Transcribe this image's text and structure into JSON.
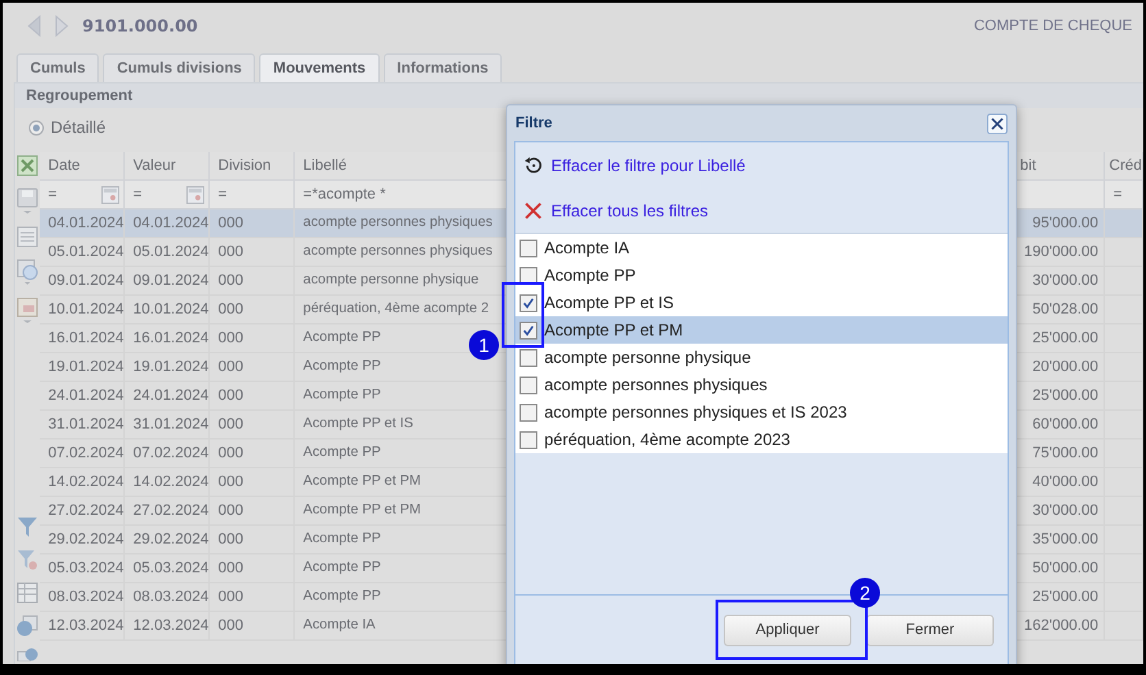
{
  "header": {
    "title": "9101.000.00",
    "account_type": "COMPTE DE CHEQUE"
  },
  "tabs": [
    {
      "label": "Cumuls",
      "selected": false
    },
    {
      "label": "Cumuls divisions",
      "selected": false
    },
    {
      "label": "Mouvements",
      "selected": true
    },
    {
      "label": "Informations",
      "selected": false
    }
  ],
  "grouping": {
    "title": "Regroupement",
    "option": {
      "label": "Détaillé",
      "selected": true
    }
  },
  "table": {
    "columns": [
      "Date",
      "Valeur",
      "Division",
      "Libellé",
      "bit",
      "Créd"
    ],
    "filters": {
      "date": "=",
      "valeur": "=",
      "division": "=",
      "libelle": "=*acompte *",
      "credit": "="
    },
    "rows": [
      {
        "cells": [
          "04.01.2024",
          "04.01.2024",
          "000",
          "acompte personnes physiques",
          "95'000.00",
          ""
        ],
        "selected": true
      },
      {
        "cells": [
          "05.01.2024",
          "05.01.2024",
          "000",
          "acompte personnes physiques",
          "190'000.00",
          ""
        ],
        "selected": false
      },
      {
        "cells": [
          "09.01.2024",
          "09.01.2024",
          "000",
          "acompte personne physique",
          "30'000.00",
          ""
        ],
        "selected": false
      },
      {
        "cells": [
          "10.01.2024",
          "10.01.2024",
          "000",
          "péréquation, 4ème acompte 2",
          "50'028.00",
          ""
        ],
        "selected": false
      },
      {
        "cells": [
          "16.01.2024",
          "16.01.2024",
          "000",
          "Acompte PP",
          "25'000.00",
          ""
        ],
        "selected": false
      },
      {
        "cells": [
          "19.01.2024",
          "19.01.2024",
          "000",
          "Acompte PP",
          "20'000.00",
          ""
        ],
        "selected": false
      },
      {
        "cells": [
          "24.01.2024",
          "24.01.2024",
          "000",
          "Acompte PP",
          "25'000.00",
          ""
        ],
        "selected": false
      },
      {
        "cells": [
          "31.01.2024",
          "31.01.2024",
          "000",
          "Acompte PP et IS",
          "60'000.00",
          ""
        ],
        "selected": false
      },
      {
        "cells": [
          "07.02.2024",
          "07.02.2024",
          "000",
          "Acompte PP",
          "75'000.00",
          ""
        ],
        "selected": false
      },
      {
        "cells": [
          "14.02.2024",
          "14.02.2024",
          "000",
          "Acompte PP et PM",
          "40'000.00",
          ""
        ],
        "selected": false
      },
      {
        "cells": [
          "27.02.2024",
          "27.02.2024",
          "000",
          "Acompte PP et PM",
          "30'000.00",
          ""
        ],
        "selected": false
      },
      {
        "cells": [
          "29.02.2024",
          "29.02.2024",
          "000",
          "Acompte PP",
          "35'000.00",
          ""
        ],
        "selected": false
      },
      {
        "cells": [
          "05.03.2024",
          "05.03.2024",
          "000",
          "Acompte PP",
          "50'000.00",
          ""
        ],
        "selected": false
      },
      {
        "cells": [
          "08.03.2024",
          "08.03.2024",
          "000",
          "Acompte PP",
          "25'000.00",
          ""
        ],
        "selected": false
      },
      {
        "cells": [
          "12.03.2024",
          "12.03.2024",
          "000",
          "Acompte IA",
          "162'000.00",
          ""
        ],
        "selected": false
      }
    ]
  },
  "dialog": {
    "title": "Filtre",
    "actions": [
      {
        "kind": "reset",
        "label": "Effacer le filtre pour Libellé"
      },
      {
        "kind": "clear",
        "label": "Effacer tous les filtres"
      }
    ],
    "options": [
      {
        "label": "Acompte IA",
        "checked": false,
        "selected": false
      },
      {
        "label": "Acompte PP",
        "checked": false,
        "selected": false
      },
      {
        "label": "Acompte PP et IS",
        "checked": true,
        "selected": false
      },
      {
        "label": "Acompte PP et PM",
        "checked": true,
        "selected": true
      },
      {
        "label": "acompte personne physique",
        "checked": false,
        "selected": false
      },
      {
        "label": "acompte personnes physiques",
        "checked": false,
        "selected": false
      },
      {
        "label": "acompte personnes physiques et IS 2023",
        "checked": false,
        "selected": false
      },
      {
        "label": "péréquation, 4ème acompte 2023",
        "checked": false,
        "selected": false
      }
    ],
    "buttons": [
      "Appliquer",
      "Fermer"
    ]
  },
  "annotations": [
    "1",
    "2"
  ]
}
